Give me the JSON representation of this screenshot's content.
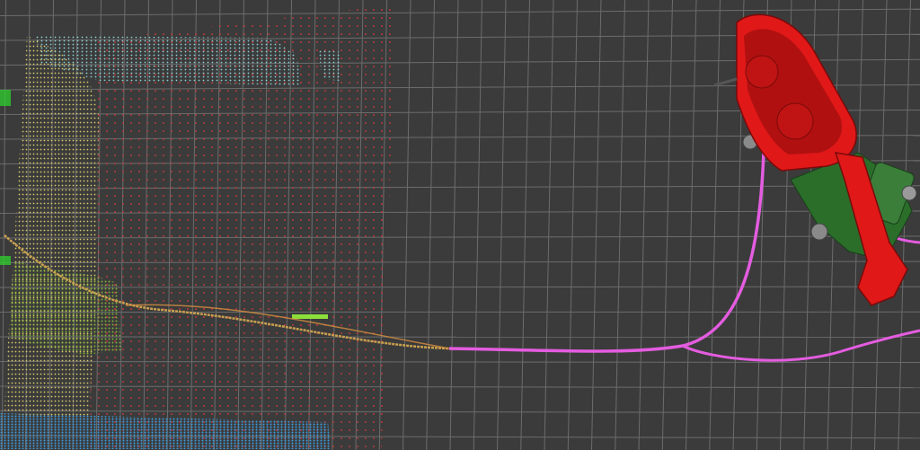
{
  "viewer": {
    "background": "#3b3b3b",
    "grid_color": "#6c6c6c",
    "layers": [
      {
        "name": "ground-points",
        "color": "#c83a3a"
      },
      {
        "name": "wall-points",
        "color": "#d8c86a"
      },
      {
        "name": "ceiling-points",
        "color": "#8ecfd6"
      },
      {
        "name": "floor-edge-points",
        "color": "#3d9be0"
      },
      {
        "name": "obstacle-points",
        "color": "#8cbf3a"
      },
      {
        "name": "planned-path",
        "color": "#e45ce0"
      },
      {
        "name": "driven-path",
        "color": "#c9a050"
      },
      {
        "name": "harvester-model",
        "color": "#e01818"
      },
      {
        "name": "tractor-model",
        "color": "#2a6e2a"
      }
    ]
  }
}
